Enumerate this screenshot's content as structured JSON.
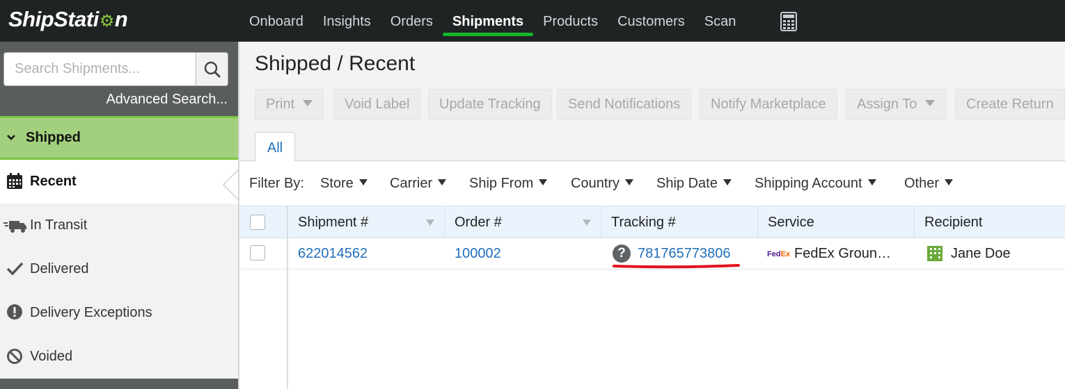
{
  "app": {
    "logo_text": "ShipStation"
  },
  "nav": {
    "items": [
      {
        "label": "Onboard"
      },
      {
        "label": "Insights"
      },
      {
        "label": "Orders"
      },
      {
        "label": "Shipments"
      },
      {
        "label": "Products"
      },
      {
        "label": "Customers"
      },
      {
        "label": "Scan"
      }
    ],
    "active": "Shipments",
    "accent_color": "#14b62a",
    "calculator_icon": "calculator-icon"
  },
  "sidebar": {
    "search": {
      "placeholder": "Search Shipments...",
      "value": ""
    },
    "advanced_search_label": "Advanced Search...",
    "section_label": "Shipped",
    "items": [
      {
        "label": "Recent",
        "icon": "calendar-icon"
      },
      {
        "label": "In Transit",
        "icon": "truck-icon"
      },
      {
        "label": "Delivered",
        "icon": "checkmark-icon"
      },
      {
        "label": "Delivery Exceptions",
        "icon": "exclamation-icon"
      },
      {
        "label": "Voided",
        "icon": "prohibited-icon"
      }
    ],
    "active_item": "Recent"
  },
  "main": {
    "breadcrumb": "Shipped / Recent",
    "toolbar": [
      {
        "label": "Print",
        "dropdown": true
      },
      {
        "label": "Void Label",
        "dropdown": false
      },
      {
        "label": "Update Tracking",
        "dropdown": false
      },
      {
        "label": "Send Notifications",
        "dropdown": false
      },
      {
        "label": "Notify Marketplace",
        "dropdown": false
      },
      {
        "label": "Assign To",
        "dropdown": true
      },
      {
        "label": "Create Return",
        "dropdown": false
      }
    ],
    "tabs": [
      {
        "label": "All"
      }
    ],
    "filter_label": "Filter By:",
    "filters": [
      {
        "label": "Store"
      },
      {
        "label": "Carrier"
      },
      {
        "label": "Ship From"
      },
      {
        "label": "Country"
      },
      {
        "label": "Ship Date"
      },
      {
        "label": "Shipping Account"
      },
      {
        "label": "Other"
      }
    ],
    "columns": [
      {
        "label": "Shipment #"
      },
      {
        "label": "Order #"
      },
      {
        "label": "Tracking #"
      },
      {
        "label": "Service"
      },
      {
        "label": "Recipient"
      }
    ],
    "rows": [
      {
        "shipment": "622014562",
        "order": "100002",
        "tracking": "781765773806",
        "tracking_status_icon": "question-icon",
        "service": "FedEx Groun…",
        "service_logo": {
          "fe": "Fed",
          "ex": "Ex"
        },
        "recipient": "Jane Doe",
        "recipient_icon": "building-icon"
      }
    ]
  },
  "colors": {
    "link": "#1f6fba",
    "shipped_section_bg": "#a3d07e",
    "annotation_underline": "#e3121b"
  }
}
